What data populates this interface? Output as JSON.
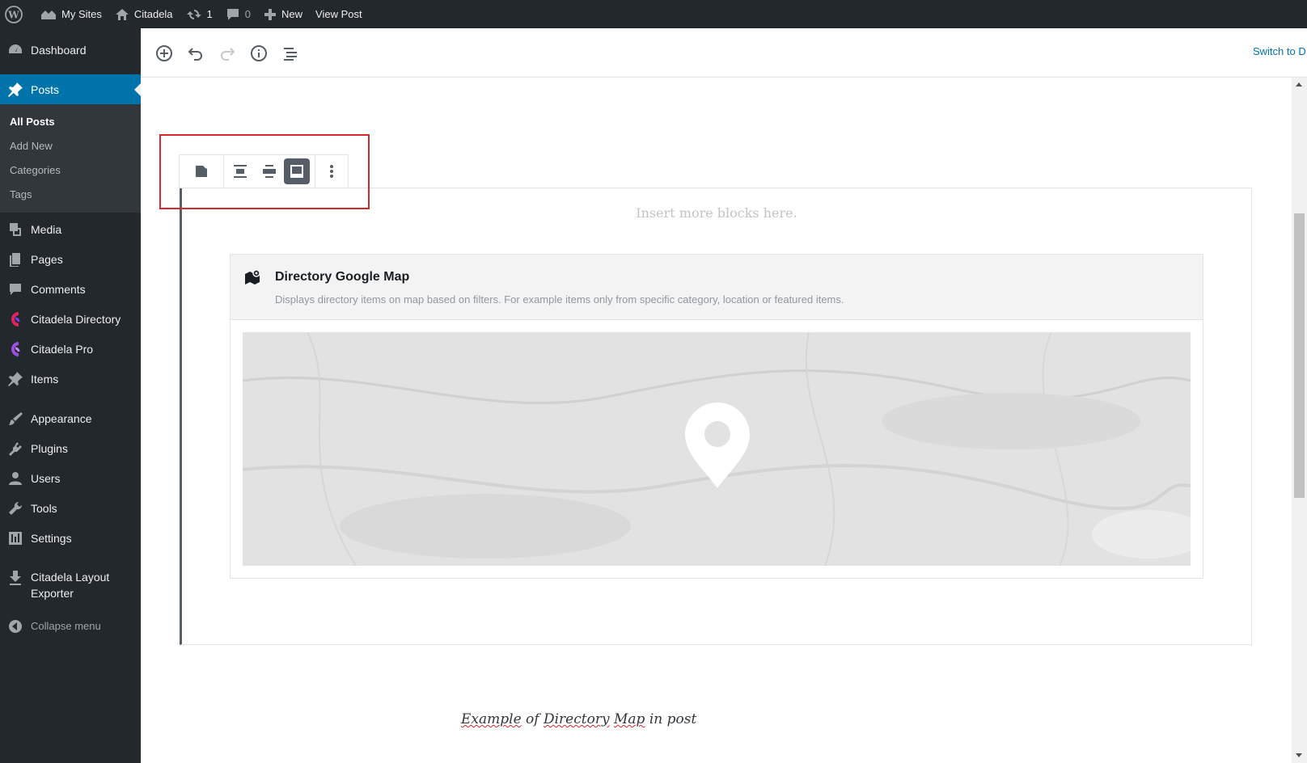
{
  "adminbar": {
    "my_sites": "My Sites",
    "site_name": "Citadela",
    "updates_count": "1",
    "comments_count": "0",
    "new_label": "New",
    "view_post": "View Post"
  },
  "sidebar": {
    "dashboard": "Dashboard",
    "posts": "Posts",
    "posts_sub": [
      "All Posts",
      "Add New",
      "Categories",
      "Tags"
    ],
    "media": "Media",
    "pages": "Pages",
    "comments": "Comments",
    "citadela_directory": "Citadela Directory",
    "citadela_pro": "Citadela Pro",
    "items": "Items",
    "appearance": "Appearance",
    "plugins": "Plugins",
    "users": "Users",
    "tools": "Tools",
    "settings": "Settings",
    "layout_exporter": "Citadela Layout Exporter",
    "collapse": "Collapse menu"
  },
  "editor": {
    "switch_link": "Switch to D",
    "insert_hint": "Insert more blocks here.",
    "block": {
      "title": "Directory Google Map",
      "description": "Displays directory items on map based on filters. For example items only from specific category, location or featured items."
    },
    "caption_parts": [
      "Example",
      "of",
      "Directory",
      "Map",
      "in post"
    ]
  },
  "colors": {
    "admin_bg": "#23282d",
    "accent": "#0073aa",
    "highlight": "#d3292c"
  }
}
